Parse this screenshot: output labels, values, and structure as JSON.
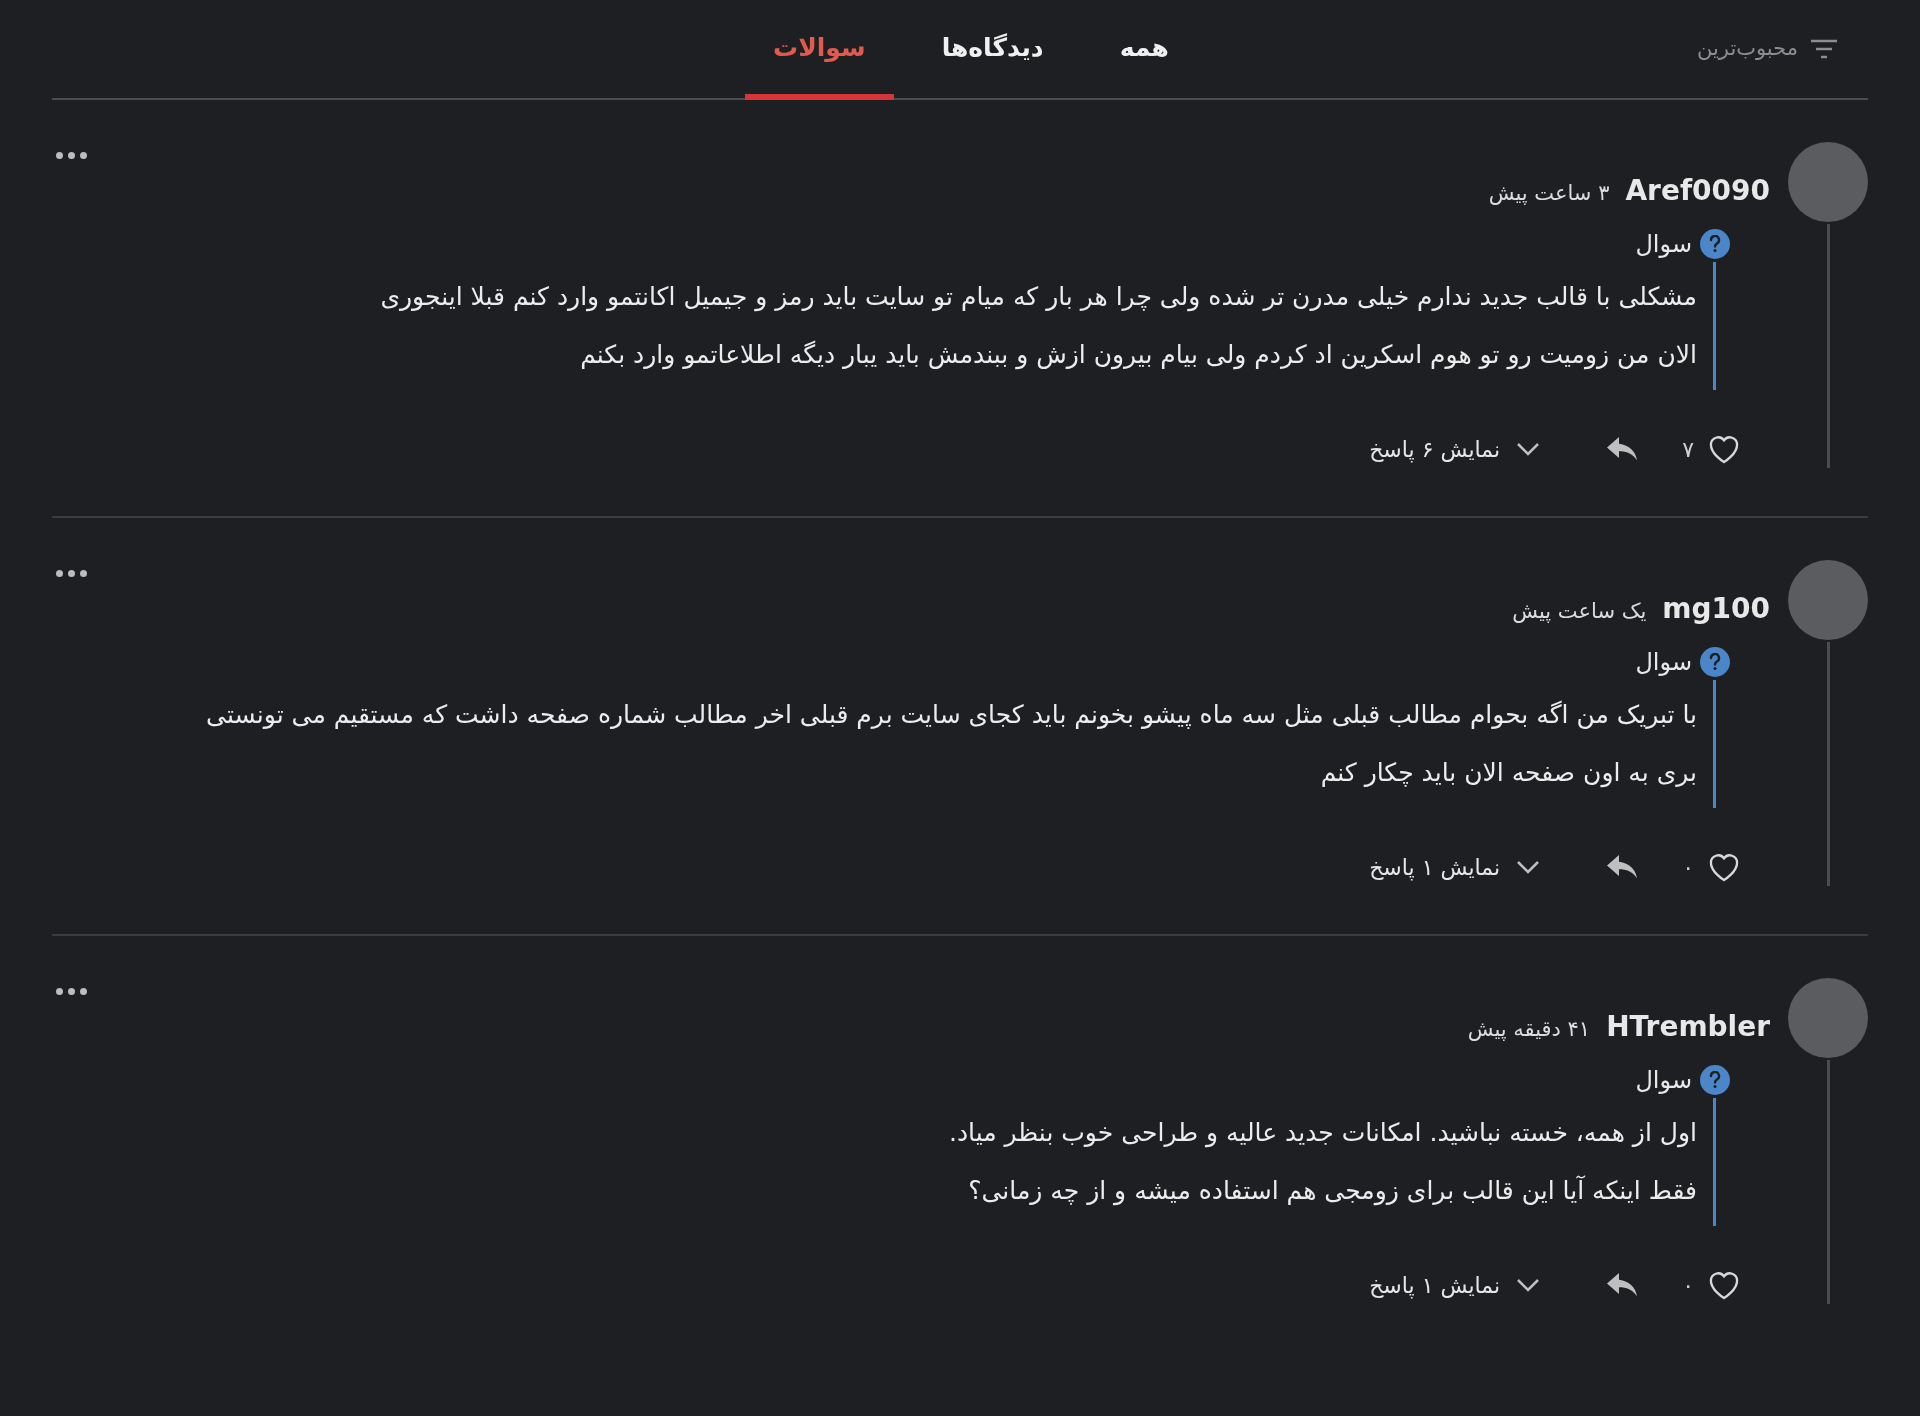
{
  "tabs": [
    {
      "label": "همه",
      "selected": false
    },
    {
      "label": "دیدگاه‌ها",
      "selected": false
    },
    {
      "label": "سوالات",
      "selected": true
    }
  ],
  "sort": {
    "label": "محبوب‌ترین"
  },
  "comments": [
    {
      "author": "Aref0090",
      "time": "۳ ساعت پیش",
      "type_label": "سوال",
      "lines": [
        "مشکلی با قالب جدید ندارم خیلی مدرن تر شده ولی چرا هر بار که میام تو سایت باید رمز و جیمیل اکانتمو وارد کنم قبلا اینجوری",
        "الان من زومیت رو تو هوم اسکرین اد کردم ولی بیام بیرون ازش و ببندمش باید یبار دیگه اطلاعاتمو وارد بکنم"
      ],
      "likes": "۷",
      "replies": "نمایش ۶ پاسخ"
    },
    {
      "author": "mg100",
      "time": "یک ساعت پیش",
      "type_label": "سوال",
      "lines": [
        "با تبریک من اگه بحوام مطالب قبلی مثل سه ماه پیشو بخونم باید کجای سایت برم قبلی اخر مطالب شماره صفحه داشت که مستقیم می تونستی",
        "بری به اون صفحه الان باید چکار کنم"
      ],
      "likes": "۰",
      "replies": "نمایش ۱ پاسخ"
    },
    {
      "author": "HTrembler",
      "time": "۴۱ دقیقه پیش",
      "type_label": "سوال",
      "lines": [
        "اول از همه، خسته نباشید. امکانات جدید عالیه و طراحی خوب بنظر میاد.",
        "فقط اینکه آیا این قالب برای زومجی هم استفاده میشه و از چه زمانی؟"
      ],
      "likes": "۰",
      "replies": "نمایش ۱ پاسخ"
    }
  ]
}
